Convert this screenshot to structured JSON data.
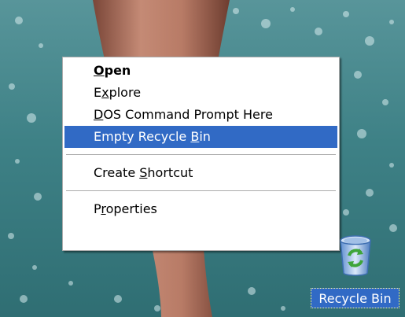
{
  "context_menu": {
    "items": [
      {
        "before": "",
        "key": "O",
        "after": "pen",
        "bold": true,
        "highlighted": false
      },
      {
        "before": "E",
        "key": "x",
        "after": "plore",
        "bold": false,
        "highlighted": false
      },
      {
        "before": "",
        "key": "D",
        "after": "OS Command Prompt Here",
        "bold": false,
        "highlighted": false
      },
      {
        "before": "Empty Recycle ",
        "key": "B",
        "after": "in",
        "bold": false,
        "highlighted": true
      },
      {
        "before": "Create ",
        "key": "S",
        "after": "hortcut",
        "bold": false,
        "highlighted": false
      },
      {
        "before": "P",
        "key": "r",
        "after": "operties",
        "bold": false,
        "highlighted": false
      }
    ]
  },
  "desktop": {
    "recycle_bin": {
      "label": "Recycle Bin",
      "icon": "recycle-bin-icon"
    }
  },
  "colors": {
    "selection": "#316ac5",
    "menu_background": "#ffffff",
    "menu_border": "#acacac",
    "desktop_water": "#3d7f83",
    "recycle_arrows": "#3ea53a"
  }
}
